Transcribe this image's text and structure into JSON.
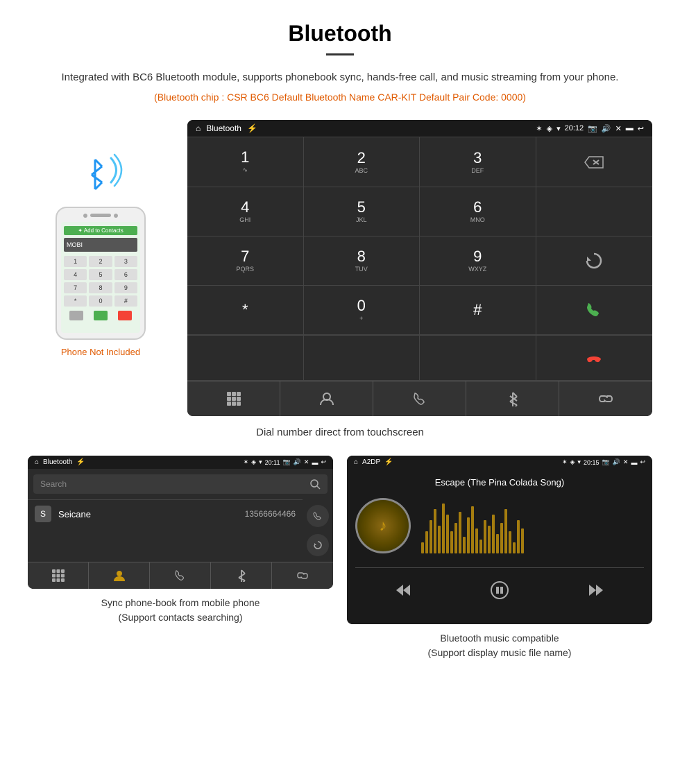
{
  "page": {
    "title": "Bluetooth",
    "divider": true,
    "description": "Integrated with BC6 Bluetooth module, supports phonebook sync, hands-free call, and music streaming from your phone.",
    "specs": "(Bluetooth chip : CSR BC6    Default Bluetooth Name CAR-KIT    Default Pair Code: 0000)"
  },
  "phone_side": {
    "not_included_label": "Phone Not Included"
  },
  "android_dialer": {
    "statusbar": {
      "app_name": "Bluetooth",
      "time": "20:12"
    },
    "keys": [
      {
        "num": "1",
        "sub": ""
      },
      {
        "num": "2",
        "sub": "ABC"
      },
      {
        "num": "3",
        "sub": "DEF"
      },
      {
        "num": "",
        "sub": ""
      },
      {
        "num": "4",
        "sub": "GHI"
      },
      {
        "num": "5",
        "sub": "JKL"
      },
      {
        "num": "6",
        "sub": "MNO"
      },
      {
        "num": "",
        "sub": ""
      },
      {
        "num": "7",
        "sub": "PQRS"
      },
      {
        "num": "8",
        "sub": "TUV"
      },
      {
        "num": "9",
        "sub": "WXYZ"
      },
      {
        "num": "",
        "sub": ""
      },
      {
        "num": "*",
        "sub": ""
      },
      {
        "num": "0",
        "sub": "+"
      },
      {
        "num": "#",
        "sub": ""
      },
      {
        "num": "",
        "sub": ""
      }
    ]
  },
  "dialer_caption": "Dial number direct from touchscreen",
  "phonebook": {
    "statusbar_app": "Bluetooth",
    "statusbar_time": "20:11",
    "search_placeholder": "Search",
    "contact_name": "Seicane",
    "contact_number": "13566664466",
    "contact_letter": "S"
  },
  "phonebook_caption_line1": "Sync phone-book from mobile phone",
  "phonebook_caption_line2": "(Support contacts searching)",
  "music": {
    "statusbar_app": "A2DP",
    "statusbar_time": "20:15",
    "song_title": "Escape (The Pina Colada Song)"
  },
  "music_caption_line1": "Bluetooth music compatible",
  "music_caption_line2": "(Support display music file name)",
  "watermark": "Seicane"
}
